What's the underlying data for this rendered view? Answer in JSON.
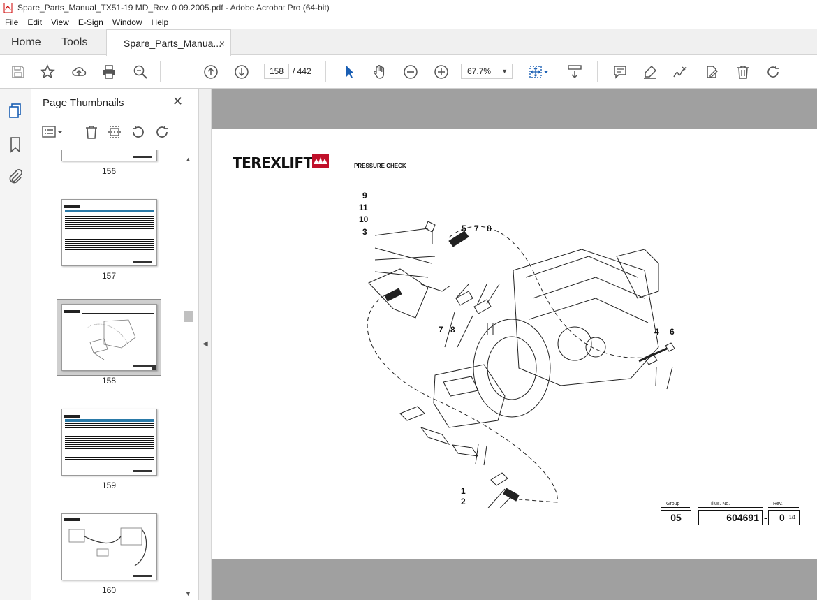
{
  "window": {
    "title": "Spare_Parts_Manual_TX51-19 MD_Rev. 0 09.2005.pdf - Adobe Acrobat Pro (64-bit)"
  },
  "menu": [
    "File",
    "Edit",
    "View",
    "E-Sign",
    "Window",
    "Help"
  ],
  "tabs": {
    "home": "Home",
    "tools": "Tools",
    "document": "Spare_Parts_Manua...",
    "close_glyph": "×"
  },
  "toolbar": {
    "current_page": "158",
    "total_pages": "/ 442",
    "zoom": "67.7%",
    "icons": [
      "save-icon",
      "bookmark-star-icon",
      "share-icon",
      "print-icon",
      "find-icon",
      "page-up-icon",
      "page-down-icon",
      "select-arrow-icon",
      "hand-icon",
      "zoom-out-icon",
      "zoom-in-icon",
      "page-fit-icon",
      "scroll-mode-icon",
      "comment-icon",
      "highlight-icon",
      "sign-icon",
      "fill-sign-icon",
      "delete-icon",
      "rotate-icon"
    ]
  },
  "left_rail": {
    "icons": [
      "pages-icon",
      "bookmarks-icon",
      "attachments-icon"
    ]
  },
  "thumbnails_panel": {
    "title": "Page Thumbnails",
    "close_glyph": "✕",
    "pages": [
      {
        "label": "156"
      },
      {
        "label": "157"
      },
      {
        "label": "158",
        "selected": true
      },
      {
        "label": "159"
      },
      {
        "label": "160"
      }
    ]
  },
  "document": {
    "logo": "TEREXLIFT",
    "heading": "PRESSURE CHECK",
    "callouts": [
      "9",
      "11",
      "10",
      "3",
      "5",
      "7",
      "8",
      "7",
      "8",
      "4",
      "6",
      "1",
      "2"
    ],
    "title_block": {
      "group_label": "Group",
      "group_value": "05",
      "illus_label": "Illus. No.",
      "illus_value": "604691",
      "rev_label": "Rev.",
      "rev_value": "0",
      "dash": "-",
      "sheet": "1/1"
    }
  }
}
